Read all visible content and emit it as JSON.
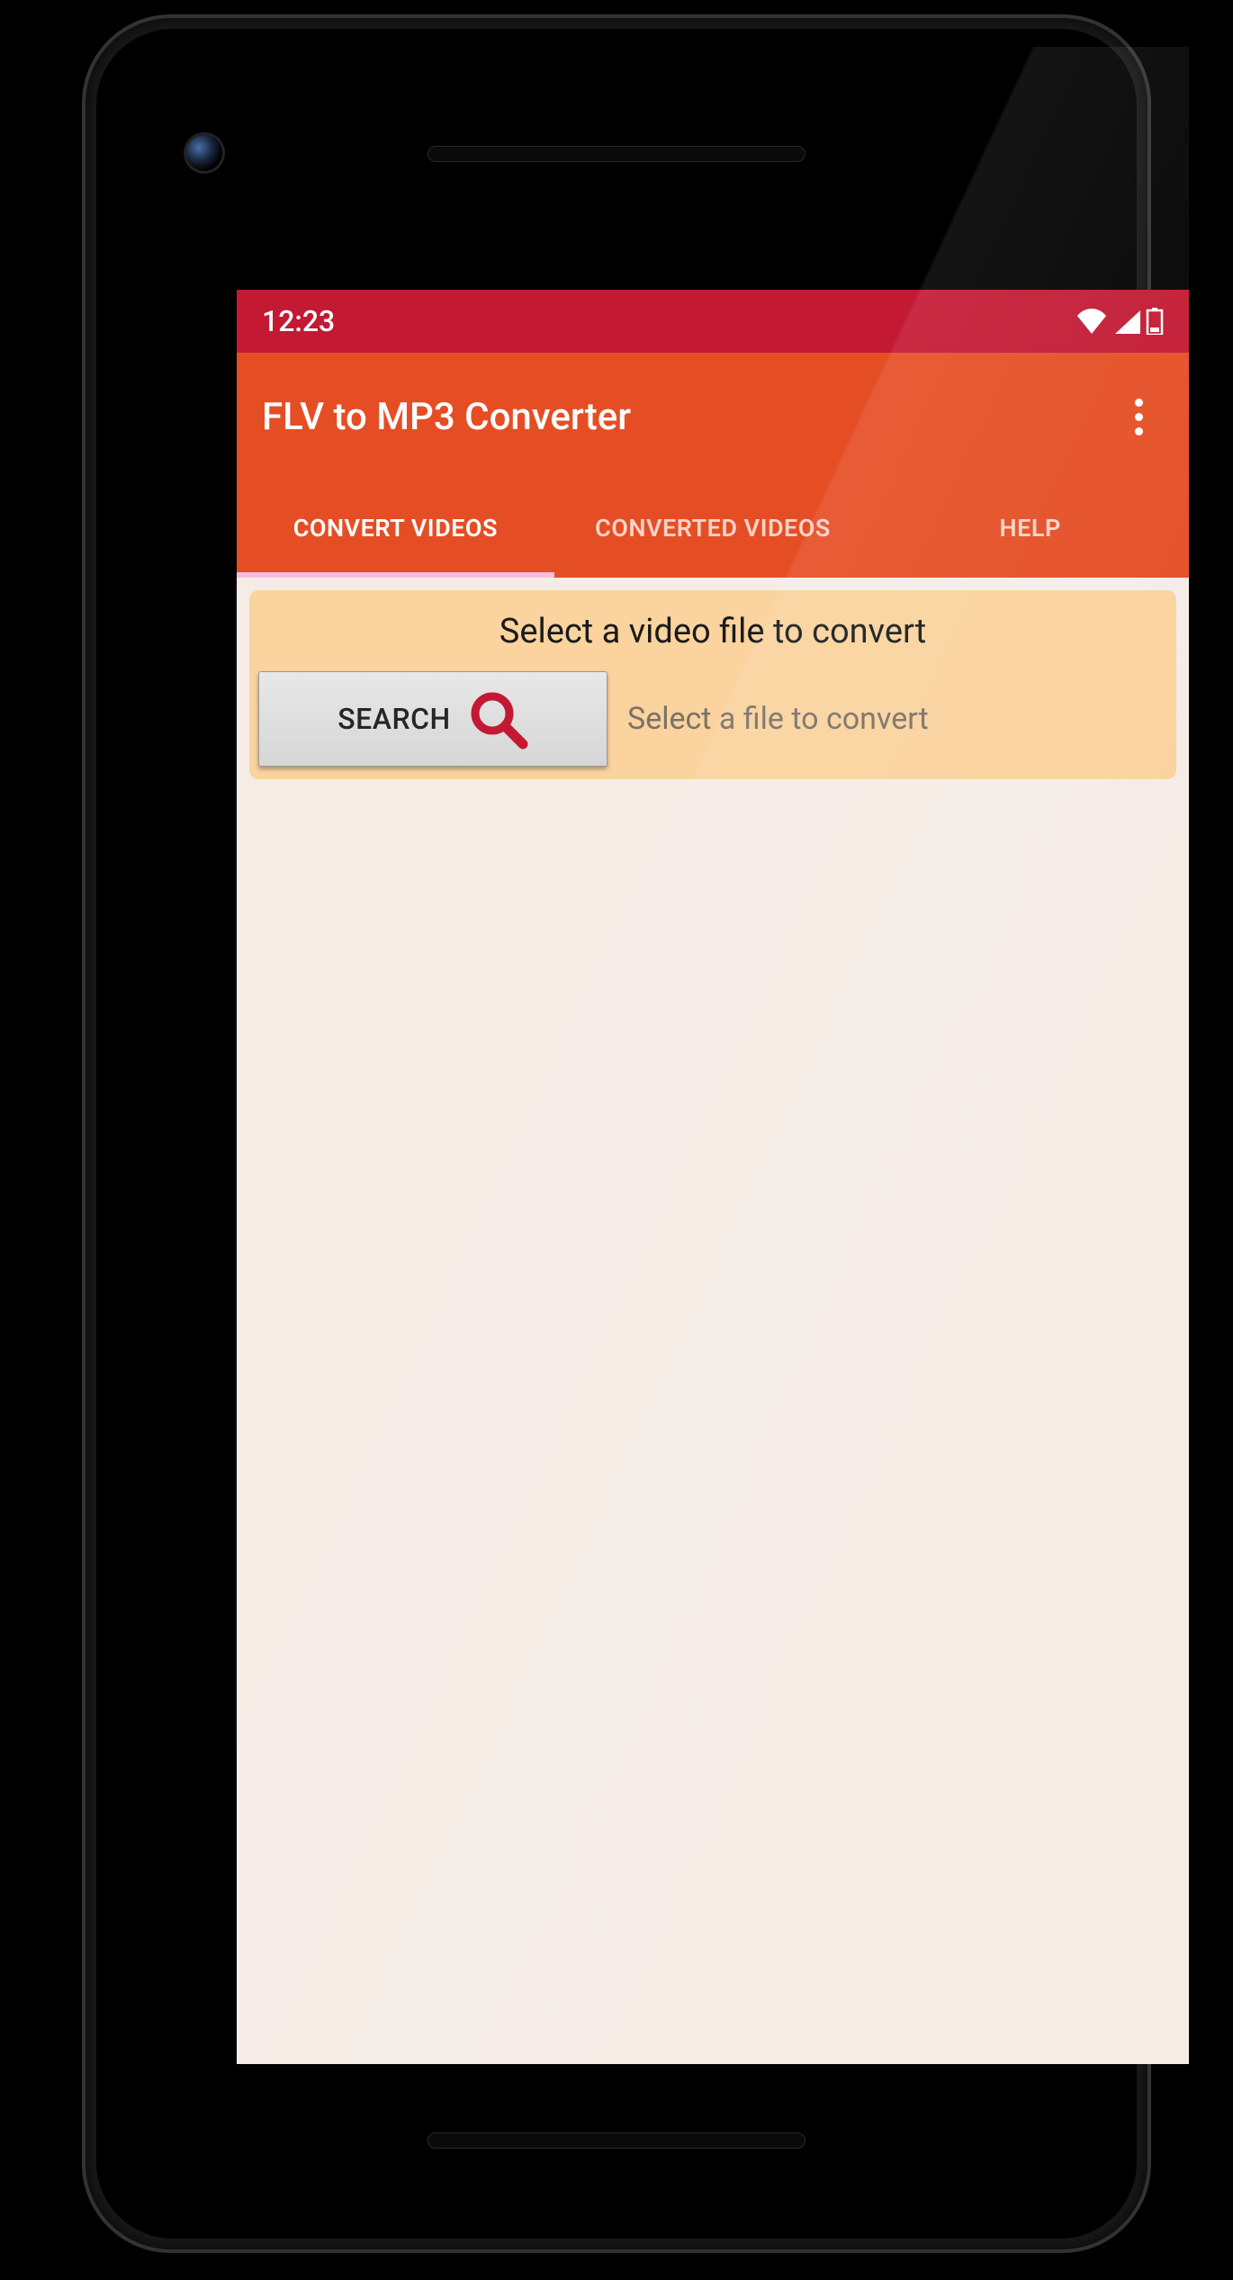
{
  "status_bar": {
    "time": "12:23"
  },
  "app_bar": {
    "title": "FLV to MP3 Converter"
  },
  "tabs": [
    {
      "label": "CONVERT VIDEOS",
      "active": true
    },
    {
      "label": "CONVERTED VIDEOS",
      "active": false
    },
    {
      "label": "HELP",
      "active": false
    }
  ],
  "convert_panel": {
    "heading": "Select a video file to convert",
    "search_button_label": "SEARCH",
    "file_placeholder": "Select a file to convert"
  },
  "colors": {
    "status_bar_bg": "#c31933",
    "app_bar_bg": "#e54e25",
    "card_bg": "#fad39e",
    "search_icon": "#c31933",
    "content_bg": "#f5ece6"
  }
}
